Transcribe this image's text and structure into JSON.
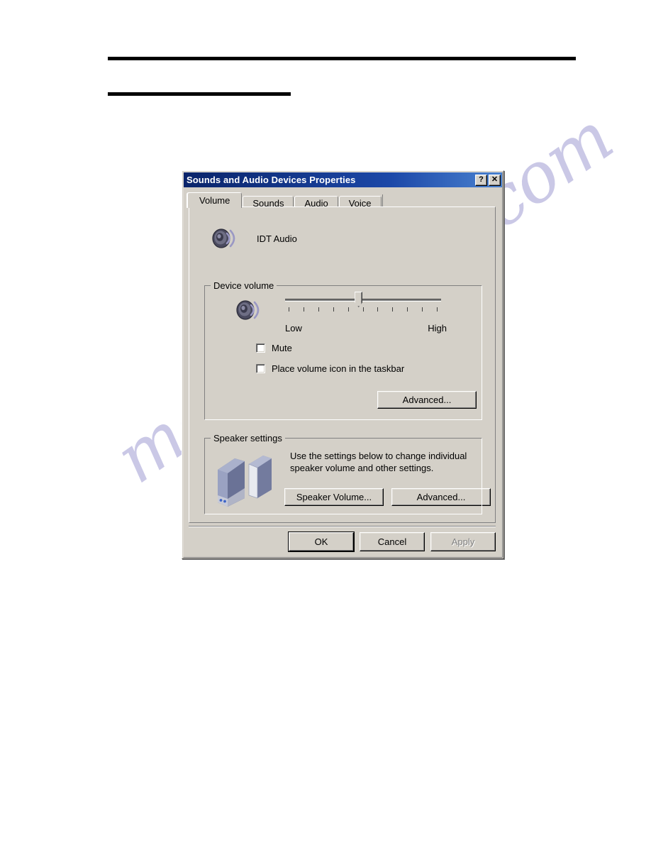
{
  "page": {
    "watermark": "manualshive.com",
    "rules": [
      "top-rule",
      "section-rule"
    ]
  },
  "dialog": {
    "title": "Sounds and Audio Devices Properties",
    "titlebar_buttons": [
      {
        "name": "help-button",
        "glyph": "?"
      },
      {
        "name": "close-button",
        "glyph": "✕"
      }
    ],
    "tabs": [
      {
        "label": "Volume",
        "active": true
      },
      {
        "label": "Sounds",
        "active": false
      },
      {
        "label": "Audio",
        "active": false
      },
      {
        "label": "Voice",
        "active": false
      }
    ],
    "device": {
      "icon": "speaker-icon",
      "name": "IDT Audio"
    },
    "device_volume": {
      "group_label": "Device volume",
      "slider": {
        "icon": "speaker-icon",
        "min_label": "Low",
        "max_label": "High",
        "value_percent": 47,
        "tick_count": 11
      },
      "checkboxes": [
        {
          "label": "Mute",
          "checked": false
        },
        {
          "label": "Place volume icon in the taskbar",
          "checked": false
        }
      ],
      "advanced_button": "Advanced..."
    },
    "speaker_settings": {
      "group_label": "Speaker settings",
      "icon": "speakers-icon",
      "description": "Use the settings below to change individual speaker volume and other settings.",
      "speaker_volume_button": "Speaker Volume...",
      "advanced_button": "Advanced..."
    },
    "footer": {
      "ok": "OK",
      "cancel": "Cancel",
      "apply": "Apply",
      "apply_disabled": true
    },
    "colors": {
      "face": "#d4d0c8",
      "titlebar_start": "#0a246a",
      "titlebar_end": "#4a82d0",
      "watermark": "#aaa8d8"
    }
  }
}
